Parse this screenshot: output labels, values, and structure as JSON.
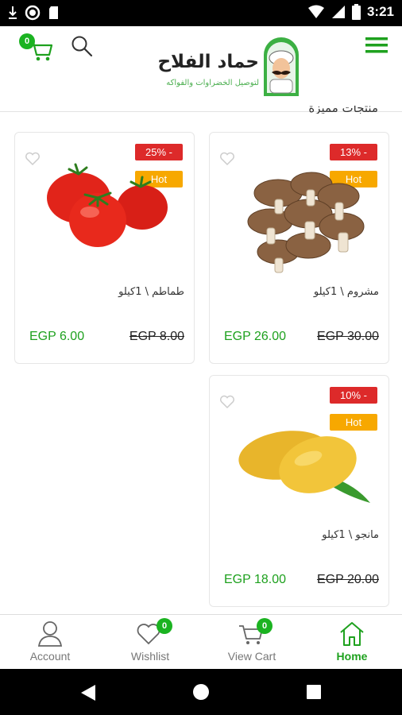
{
  "status_bar": {
    "time": "3:21"
  },
  "header": {
    "cart_count": "0",
    "logo_title": "حماد الفلاح",
    "logo_subtitle": "لتوصيل الخضراوات والفواكه"
  },
  "section": {
    "title": "منتجات مميزة"
  },
  "products": [
    {
      "name": "مشروم \\ 1كيلو",
      "discount": "13% -",
      "tag": "Hot",
      "price": "EGP 26.00",
      "old_price": "EGP 30.00"
    },
    {
      "name": "طماطم \\ 1كيلو",
      "discount": "25% -",
      "tag": "Hot",
      "price": "EGP 6.00",
      "old_price": "EGP 8.00"
    },
    {
      "name": "مانجو \\ 1كيلو",
      "discount": "10% -",
      "tag": "Hot",
      "price": "EGP 18.00",
      "old_price": "EGP 20.00"
    }
  ],
  "bottom_nav": {
    "items": [
      {
        "label": "Account"
      },
      {
        "label": "Wishlist",
        "count": "0"
      },
      {
        "label": "View Cart",
        "count": "0"
      },
      {
        "label": "Home"
      }
    ]
  },
  "colors": {
    "accent": "#1ea11e",
    "discount": "#dd2a2a",
    "hot": "#f7a800"
  }
}
